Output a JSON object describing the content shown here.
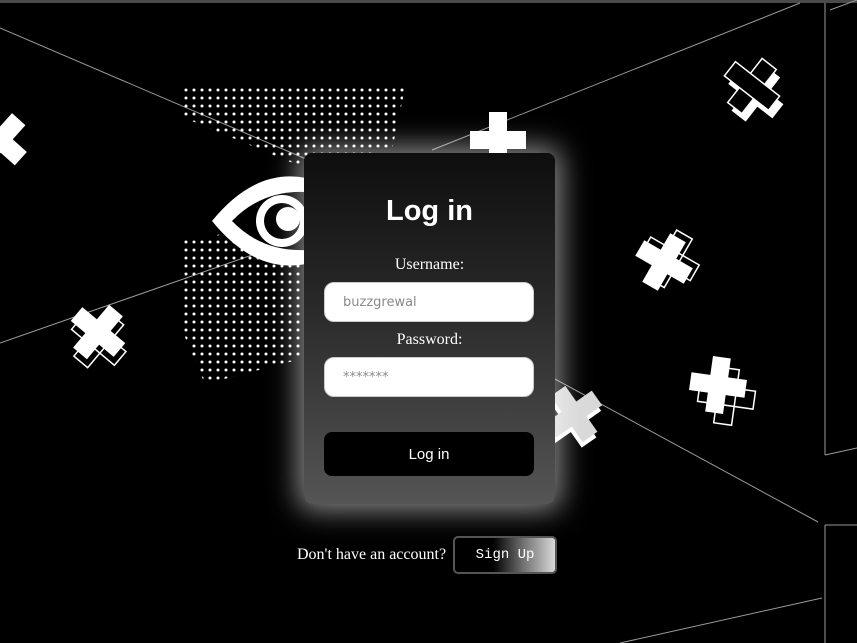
{
  "login_card": {
    "title": "Log in",
    "username_label": "Username:",
    "username_value": "buzzgrewal",
    "password_label": "Password:",
    "password_value": "*******",
    "submit_label": "Log in"
  },
  "signup": {
    "prompt": "Don't have an account?",
    "button_label": "Sign Up"
  },
  "decorations": {
    "icons": [
      "eye-icon",
      "cross-icon",
      "dot-grid-pattern"
    ],
    "colors": {
      "background": "#000000",
      "foreground": "#ffffff",
      "card_gradient_top": "#0e0e0e",
      "card_gradient_bottom": "#555555"
    }
  }
}
